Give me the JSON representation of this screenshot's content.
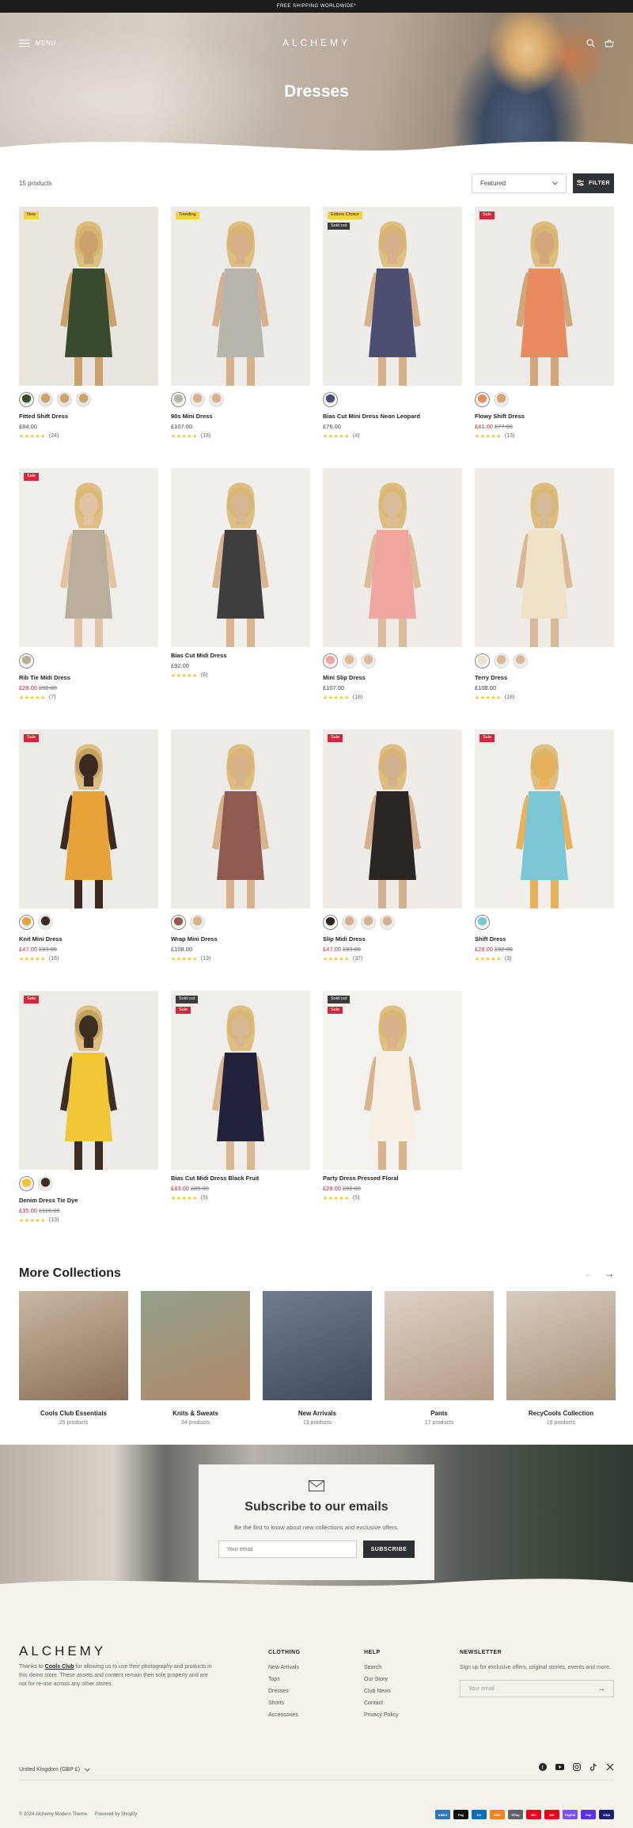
{
  "announcement": "FREE SHIPPING WORLDWIDE*",
  "header": {
    "menu_label": "MENU",
    "logo": "ALCHEMY"
  },
  "hero": {
    "title": "Dresses"
  },
  "toolbar": {
    "count": "15 products",
    "sort_value": "Featured",
    "filter_label": "FILTER"
  },
  "products": [
    {
      "name": "Fitted Shift Dress",
      "price": "£84.00",
      "compare": "",
      "sale": false,
      "reviews": "(24)",
      "badges": [
        "New"
      ],
      "swatches": 4,
      "colors": [
        "#e9e6df",
        "#3a4a2c",
        "#c9a36b"
      ]
    },
    {
      "name": "90s Mini Dress",
      "price": "£107.00",
      "compare": "",
      "sale": false,
      "reviews": "(18)",
      "badges": [
        "Trending"
      ],
      "swatches": 3,
      "colors": [
        "#ecebe7",
        "#b7b5ac",
        "#d7b18b"
      ]
    },
    {
      "name": "Bias Cut Mini Dress Neon Leopard",
      "price": "£76.00",
      "compare": "",
      "sale": false,
      "reviews": "(4)",
      "badges": [
        "Editors Choice",
        "Sold out"
      ],
      "swatches": 1,
      "colors": [
        "#efedea",
        "#4c4e72",
        "#d7b18b"
      ]
    },
    {
      "name": "Flowy Shift Dress",
      "price": "£41.00",
      "compare": "£77.00",
      "sale": true,
      "reviews": "(13)",
      "badges": [
        "Sale"
      ],
      "swatches": 2,
      "colors": [
        "#ecebe8",
        "#e98a5f",
        "#d3a57a"
      ]
    },
    {
      "name": "Rib Tie Midi Dress",
      "price": "£28.00",
      "compare": "£92.00",
      "sale": true,
      "reviews": "(7)",
      "badges": [
        "Sale"
      ],
      "swatches": 1,
      "colors": [
        "#f0eeea",
        "#b9ad9c",
        "#e2c3a3"
      ]
    },
    {
      "name": "Bias Cut Midi Dress",
      "price": "£92.00",
      "compare": "",
      "sale": false,
      "reviews": "(6)",
      "badges": [],
      "swatches": 0,
      "colors": [
        "#f0efec",
        "#3e3e3e",
        "#d8b491"
      ]
    },
    {
      "name": "Mini Slip Dress",
      "price": "£107.00",
      "compare": "",
      "sale": false,
      "reviews": "(18)",
      "badges": [],
      "swatches": 3,
      "colors": [
        "#efece8",
        "#f0a6a0",
        "#dcbb9a"
      ]
    },
    {
      "name": "Terry Dress",
      "price": "£108.00",
      "compare": "",
      "sale": false,
      "reviews": "(18)",
      "badges": [],
      "swatches": 3,
      "colors": [
        "#efece8",
        "#efe2c8",
        "#d8b997"
      ]
    },
    {
      "name": "Knit Mini Dress",
      "price": "£47.00",
      "compare": "£93.00",
      "sale": true,
      "reviews": "(16)",
      "badges": [
        "Sale"
      ],
      "swatches": 2,
      "colors": [
        "#ecebe7",
        "#e7a33a",
        "#3c2a22"
      ]
    },
    {
      "name": "Wrap Mini Dress",
      "price": "£108.00",
      "compare": "",
      "sale": false,
      "reviews": "(13)",
      "badges": [],
      "swatches": 2,
      "colors": [
        "#ecebe7",
        "#8f5b50",
        "#d7b28b"
      ]
    },
    {
      "name": "Slip Midi Dress",
      "price": "£47.00",
      "compare": "£93.00",
      "sale": true,
      "reviews": "(37)",
      "badges": [
        "Sale"
      ],
      "swatches": 4,
      "colors": [
        "#efece8",
        "#2a2624",
        "#d5b090"
      ]
    },
    {
      "name": "Shift Dress",
      "price": "£28.00",
      "compare": "£92.00",
      "sale": true,
      "reviews": "(3)",
      "badges": [
        "Sale"
      ],
      "swatches": 1,
      "colors": [
        "#f0efeb",
        "#7cc7d5",
        "#e9b15a"
      ]
    },
    {
      "name": "Denim Dress Tie Dye",
      "price": "£35.00",
      "compare": "£116.00",
      "sale": true,
      "reviews": "(13)",
      "badges": [
        "Sale"
      ],
      "swatches": 2,
      "colors": [
        "#ecebe7",
        "#f2c737",
        "#3d2e24"
      ]
    },
    {
      "name": "Bias Cut Midi Dress Black Fruit",
      "price": "£43.00",
      "compare": "£85.00",
      "sale": true,
      "reviews": "(5)",
      "badges": [
        "Sold out",
        "Sale"
      ],
      "swatches": 0,
      "colors": [
        "#efeeea",
        "#22213a",
        "#d9b792"
      ]
    },
    {
      "name": "Party Dress Pressed Floral",
      "price": "£28.00",
      "compare": "£92.00",
      "sale": true,
      "reviews": "(5)",
      "badges": [
        "Sold out",
        "Sale"
      ],
      "swatches": 0,
      "colors": [
        "#f3f2ef",
        "#f6efe3",
        "#d9b38e"
      ]
    }
  ],
  "more": {
    "title": "More Collections",
    "items": [
      {
        "title": "Cools Club Essentials",
        "count": "25 products",
        "c1": "#c9b8a3",
        "c2": "#8a6f56"
      },
      {
        "title": "Knits & Sweats",
        "count": "34 products",
        "c1": "#93a08a",
        "c2": "#b08a6b"
      },
      {
        "title": "New Arrivals",
        "count": "13 products",
        "c1": "#6f7d8f",
        "c2": "#3f4a5c"
      },
      {
        "title": "Pants",
        "count": "17 products",
        "c1": "#dcd2c6",
        "c2": "#b59b86"
      },
      {
        "title": "RecyCools Collection",
        "count": "16 products",
        "c1": "#d6cdbf",
        "c2": "#a79077"
      }
    ]
  },
  "subscribe": {
    "title": "Subscribe to our emails",
    "text": "Be the first to know about new collections and exclusive offers.",
    "placeholder": "Your email",
    "button": "SUBSCRIBE"
  },
  "footer": {
    "logo": "ALCHEMY",
    "about_pre": "Thanks to ",
    "about_link": "Cools Club",
    "about_post": " for allowing us to use their photography and products in this demo store. These assets and content remain their sole property and are not for re-use across any other stores.",
    "col1_title": "CLOTHING",
    "col1": [
      "New Arrivals",
      "Tops",
      "Dresses",
      "Shorts",
      "Accessories"
    ],
    "col2_title": "HELP",
    "col2": [
      "Search",
      "Our Story",
      "Club News",
      "Contact",
      "Privacy Policy"
    ],
    "news_title": "NEWSLETTER",
    "news_text": "Sign up for exclusive offers, original stories, events and more.",
    "news_placeholder": "Your email",
    "country": "United Kingdom (GBP £)",
    "copyright": "© 2024 Alchemy Modern Theme.",
    "powered": "Powered by Shopify",
    "payments": [
      "AMEX",
      "Pay",
      "DC",
      "DISC",
      "GPay",
      "MC",
      "MC",
      "PayPal",
      "Pay",
      "VISA"
    ]
  }
}
